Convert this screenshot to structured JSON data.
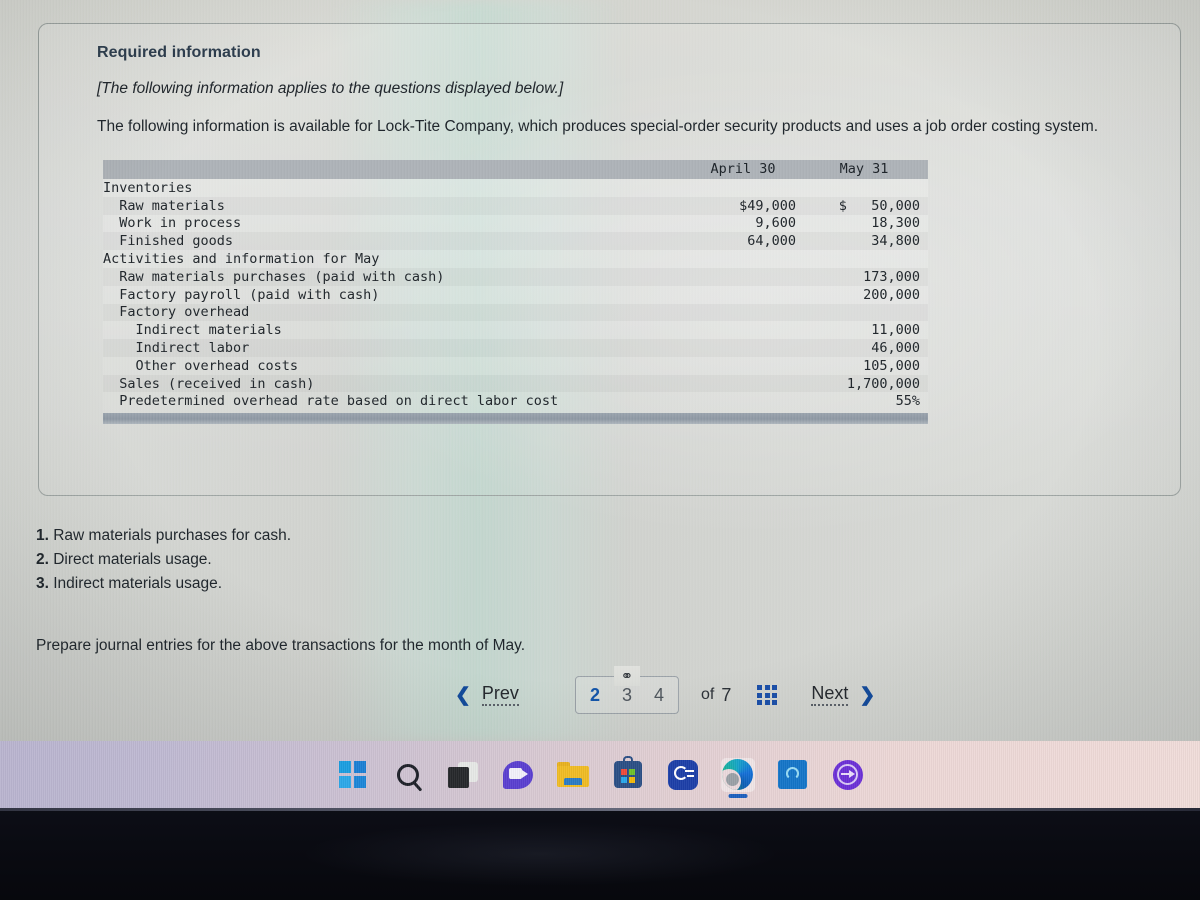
{
  "card": {
    "required_title": "Required information",
    "applies_note": "[The following information applies to the questions displayed below.]",
    "intro": "The following information is available for Lock-Tite Company, which produces special-order security products and uses a job order costing system."
  },
  "table": {
    "col_blank": "",
    "col1": "April 30",
    "col2": "May 31",
    "rows": [
      {
        "label": "Inventories",
        "c1": "",
        "c2": ""
      },
      {
        "label": "  Raw materials",
        "c1": "$49,000",
        "c2": "$   50,000"
      },
      {
        "label": "  Work in process",
        "c1": "9,600",
        "c2": "18,300"
      },
      {
        "label": "  Finished goods",
        "c1": "64,000",
        "c2": "34,800"
      },
      {
        "label": "Activities and information for May",
        "c1": "",
        "c2": ""
      },
      {
        "label": "  Raw materials purchases (paid with cash)",
        "c1": "",
        "c2": "173,000"
      },
      {
        "label": "  Factory payroll (paid with cash)",
        "c1": "",
        "c2": "200,000"
      },
      {
        "label": "  Factory overhead",
        "c1": "",
        "c2": ""
      },
      {
        "label": "    Indirect materials",
        "c1": "",
        "c2": "11,000"
      },
      {
        "label": "    Indirect labor",
        "c1": "",
        "c2": "46,000"
      },
      {
        "label": "    Other overhead costs",
        "c1": "",
        "c2": "105,000"
      },
      {
        "label": "  Sales (received in cash)",
        "c1": "",
        "c2": "1,700,000"
      },
      {
        "label": "  Predetermined overhead rate based on direct labor cost",
        "c1": "",
        "c2": "55%"
      }
    ]
  },
  "questions": [
    {
      "num": "1.",
      "text": "Raw materials purchases for cash."
    },
    {
      "num": "2.",
      "text": "Direct materials usage."
    },
    {
      "num": "3.",
      "text": "Indirect materials usage."
    }
  ],
  "prepare_text": "Prepare journal entries for the above transactions for the month of May.",
  "pager": {
    "prev_label": "Prev",
    "next_label": "Next",
    "prev_chevron": "❮",
    "next_chevron": "❯",
    "link_icon": "⚭",
    "pages": [
      {
        "num": "2",
        "current": true
      },
      {
        "num": "3",
        "current": false
      },
      {
        "num": "4",
        "current": false
      }
    ],
    "of_label": "of",
    "total_pages": "7",
    "grid_icon": "grid-icon",
    "accent_color": "#1354a8"
  },
  "taskbar": {
    "items": [
      {
        "name": "start-button",
        "icon": "windows-logo-icon",
        "active": false
      },
      {
        "name": "search-button",
        "icon": "search-icon",
        "active": false
      },
      {
        "name": "task-view-button",
        "icon": "task-view-icon",
        "active": false
      },
      {
        "name": "chat-button",
        "icon": "chat-video-icon",
        "active": false
      },
      {
        "name": "file-explorer-button",
        "icon": "folder-icon",
        "active": false
      },
      {
        "name": "microsoft-store-button",
        "icon": "store-bag-icon",
        "active": false
      },
      {
        "name": "search-app-button",
        "icon": "magnifier-blue-icon",
        "active": false
      },
      {
        "name": "microsoft-edge-button",
        "icon": "edge-icon",
        "active": true
      },
      {
        "name": "blue-app-button",
        "icon": "blue-circle-app-icon",
        "active": false
      },
      {
        "name": "purple-arrow-button",
        "icon": "arrow-circle-icon",
        "active": false
      }
    ]
  }
}
